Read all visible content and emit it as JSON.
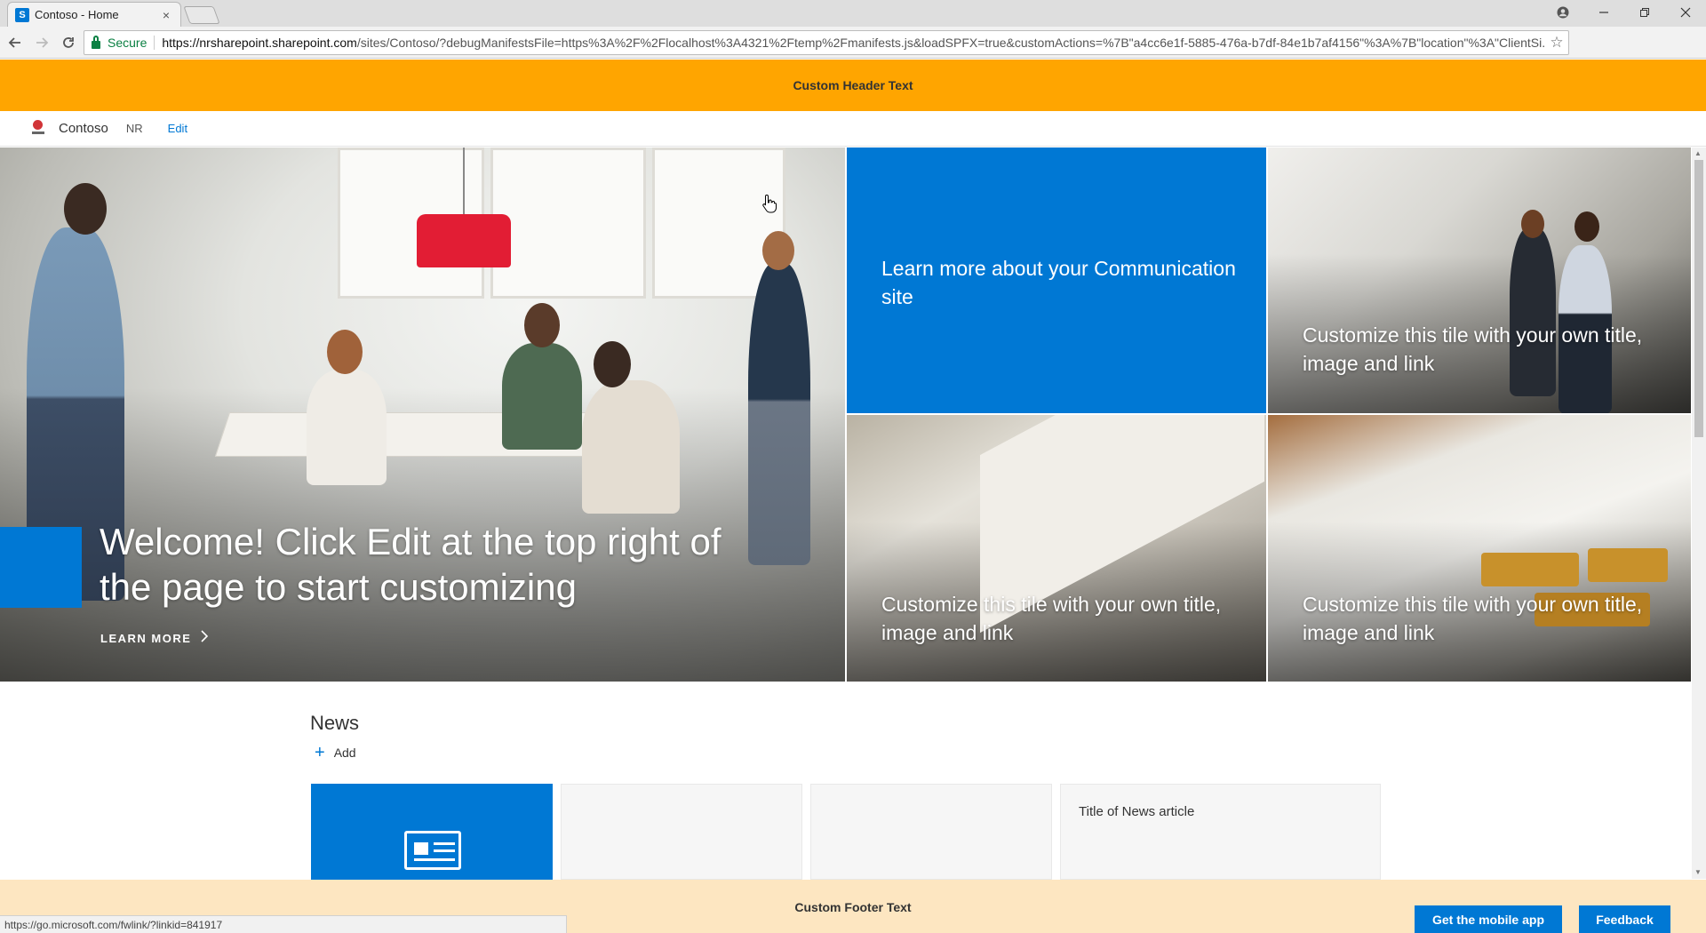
{
  "browser": {
    "tab_title": "Contoso - Home",
    "favicon_letter": "S",
    "tab_close": "×",
    "secure_label": "Secure",
    "url_host": "https://nrsharepoint.sharepoint.com",
    "url_rest": "/sites/Contoso/?debugManifestsFile=https%3A%2F%2Flocalhost%3A4321%2Ftemp%2Fmanifests.js&loadSPFX=true&customActions=%7B\"a4cc6e1f-5885-476a-b7df-84e1b7af4156\"%3A%7B\"location\"%3A\"ClientSi...",
    "status_url": "https://go.microsoft.com/fwlink/?linkid=841917"
  },
  "custom_header": {
    "text": "Custom Header Text"
  },
  "site": {
    "name": "Contoso",
    "nav_nr": "NR",
    "edit_label": "Edit"
  },
  "hero": {
    "main_title": "Welcome! Click Edit at the top right of the page to start customizing",
    "learn_more": "LEARN MORE",
    "tiles": [
      {
        "text": "Learn more about your Communication site"
      },
      {
        "text": "Customize this tile with your own title, image and link"
      },
      {
        "text": "Customize this tile with your own title, image and link"
      },
      {
        "text": "Customize this tile with your own title, image and link"
      }
    ]
  },
  "news": {
    "title": "News",
    "add_label": "Add",
    "article_title": "Title of News article"
  },
  "footer": {
    "text": "Custom Footer Text",
    "mobile_app_button": "Get the mobile app",
    "feedback_button": "Feedback"
  },
  "colors": {
    "header_bg": "#ffa500",
    "footer_bg": "#fde6c1",
    "accent": "#0078d4"
  }
}
